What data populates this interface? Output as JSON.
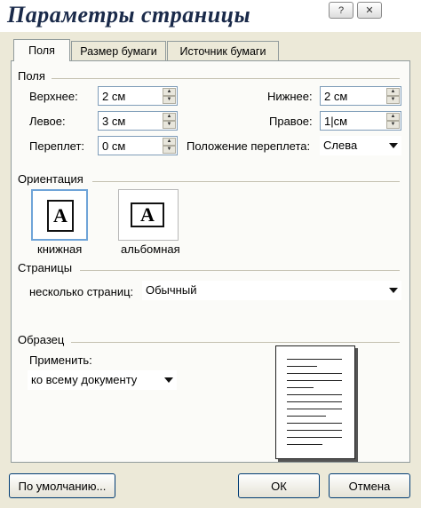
{
  "window": {
    "title": "Параметры страницы",
    "help_glyph": "?",
    "close_glyph": "✕"
  },
  "tabs": [
    {
      "label": "Поля",
      "active": true
    },
    {
      "label": "Размер бумаги",
      "active": false
    },
    {
      "label": "Источник бумаги",
      "active": false
    }
  ],
  "margins": {
    "group_label": "Поля",
    "top": {
      "label": "Верхнее:",
      "value": "2 см"
    },
    "bottom": {
      "label": "Нижнее:",
      "value": "2 см"
    },
    "left": {
      "label": "Левое:",
      "value": "3 см"
    },
    "right": {
      "label": "Правое:",
      "value": "1|см"
    },
    "gutter": {
      "label": "Переплет:",
      "value": "0 см"
    },
    "gutter_position": {
      "label": "Положение переплета:",
      "value": "Слева"
    }
  },
  "orientation": {
    "group_label": "Ориентация",
    "portrait": {
      "label": "книжная",
      "glyph": "A",
      "selected": true
    },
    "landscape": {
      "label": "альбомная",
      "glyph": "A",
      "selected": false
    }
  },
  "pages": {
    "group_label": "Страницы",
    "multiple_label": "несколько страниц:",
    "multiple_value": "Обычный"
  },
  "preview": {
    "group_label": "Образец",
    "apply_label": "Применить:",
    "apply_value": "ко всему документу"
  },
  "buttons": {
    "default": "По умолчанию...",
    "ok": "ОК",
    "cancel": "Отмена"
  },
  "icons": {
    "help": "help-icon",
    "close": "close-icon",
    "spin_up": "spin-up-icon",
    "spin_down": "spin-down-icon",
    "dropdown": "dropdown-arrow-icon",
    "portrait": "portrait-page-icon",
    "landscape": "landscape-page-icon"
  }
}
